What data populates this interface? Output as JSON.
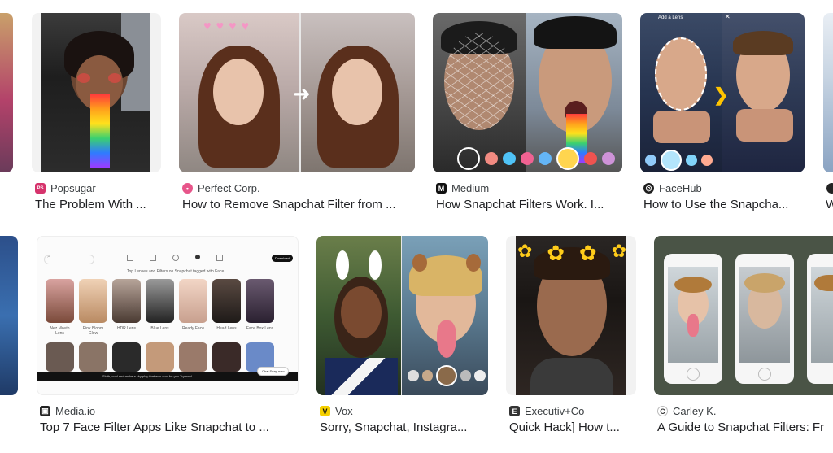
{
  "results": [
    {
      "source": "Popsugar",
      "title": "The Problem With ...",
      "favicon_color": "#d6336c",
      "favicon_letter": "PS"
    },
    {
      "source": "Perfect Corp.",
      "title": "How to Remove Snapchat Filter from ...",
      "favicon_color": "#e7558a",
      "favicon_letter": "•"
    },
    {
      "source": "Medium",
      "title": "How Snapchat Filters Work. I...",
      "favicon_color": "#111111",
      "favicon_letter": "M"
    },
    {
      "source": "FaceHub",
      "title": "How to Use the Snapcha...",
      "favicon_color": "#1f1f1f",
      "favicon_letter": "◎"
    },
    {
      "source": "Media.io",
      "title": "Top 7 Face Filter Apps Like Snapchat to ...",
      "favicon_color": "#222222",
      "favicon_letter": "▣"
    },
    {
      "source": "Vox",
      "title": "Sorry, Snapchat, Instagra...",
      "favicon_color": "#f5d000",
      "favicon_letter": "V"
    },
    {
      "source": "Executiv+Co",
      "title": "Quick Hack] How t...",
      "favicon_color": "#333333",
      "favicon_letter": "E"
    },
    {
      "source": "Carley K.",
      "title": "A Guide to Snapchat Filters: Fr",
      "favicon_color": "#ffffff",
      "favicon_letter": "C"
    },
    {
      "title": "W"
    }
  ],
  "thumb_text": {
    "add_lens": "Add a Lens",
    "mediaio_banner": "Top Lenses and Filters on Snapchat tagged with Face",
    "mediaio_lens_labels": [
      "Nez Mouth Lens",
      "Pink Bloom Glow",
      "HDR Lens",
      "Blue Lens",
      "Ready Face",
      "Head Lens",
      "Face Box Lens"
    ],
    "mediaio_footer": "Sloth, cool and make a sky play that was cool for you Try now!",
    "mediaio_download": "Download",
    "mediaio_toast": "Chat Snap now"
  }
}
